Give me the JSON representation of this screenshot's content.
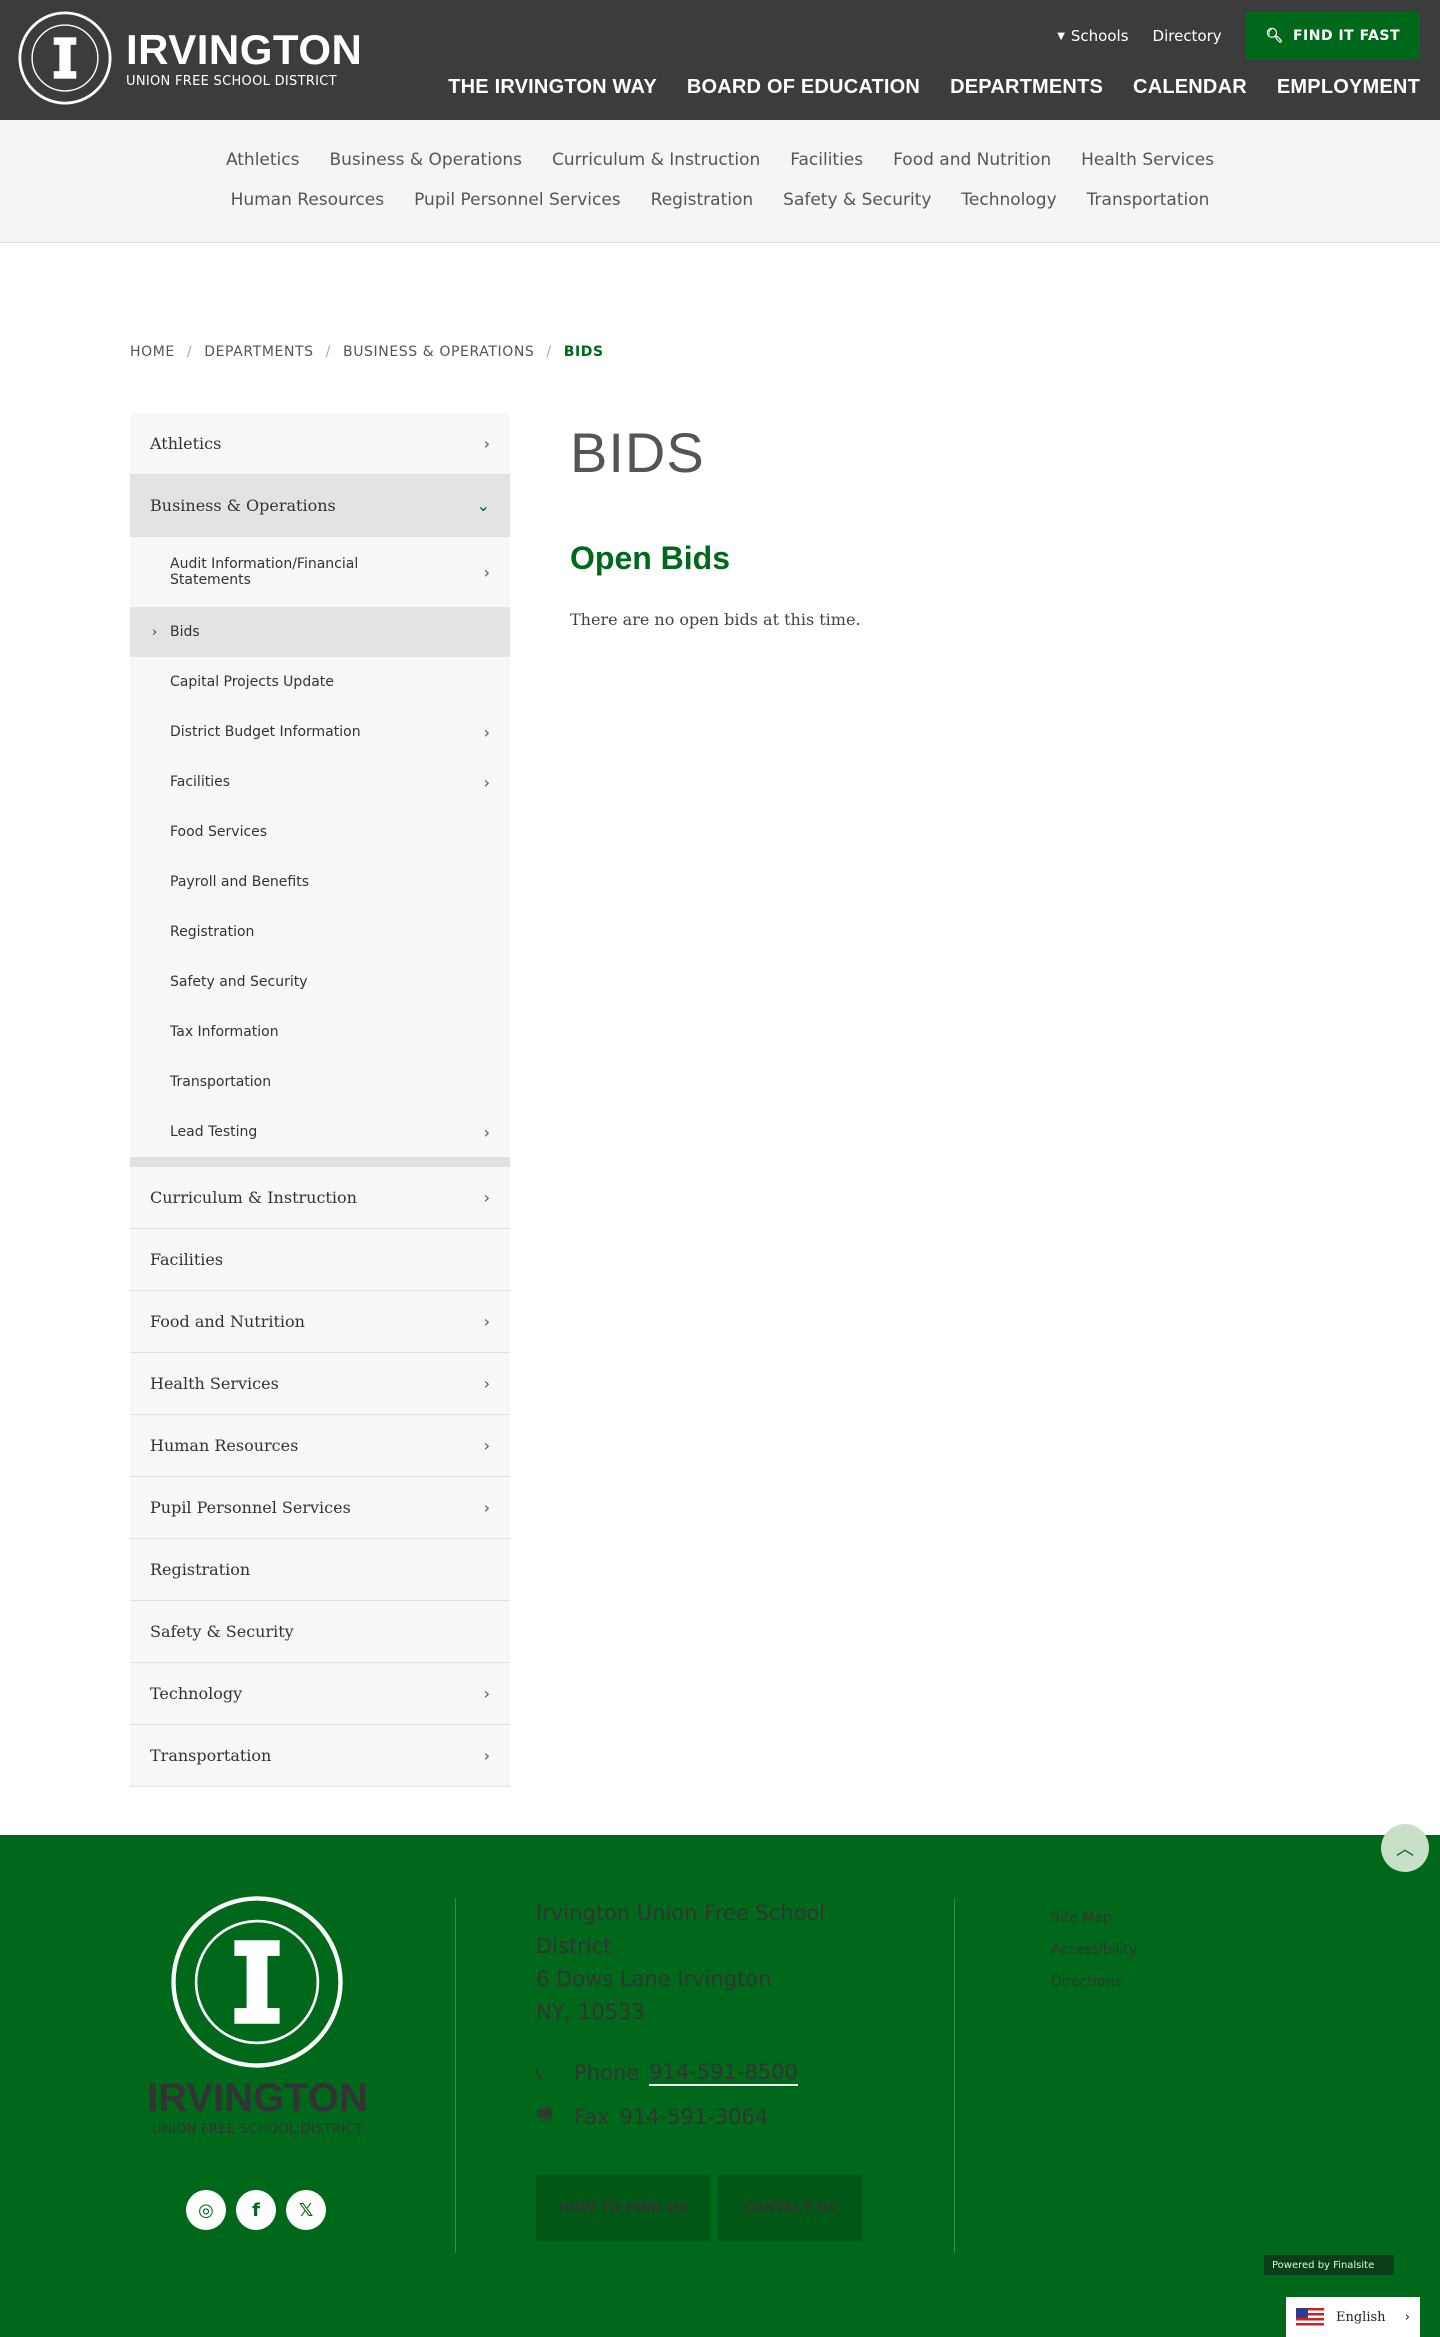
{
  "header": {
    "brand_name": "IRVINGTON",
    "brand_sub": "UNION FREE SCHOOL DISTRICT",
    "seal_text": "IRVINGTON · UNION FREE SCHOOL DISTRICT",
    "util": {
      "schools": "Schools",
      "directory": "Directory",
      "find_it_fast": "FIND IT FAST"
    },
    "main_nav": [
      "THE IRVINGTON WAY",
      "BOARD OF EDUCATION",
      "DEPARTMENTS",
      "CALENDAR",
      "EMPLOYMENT"
    ]
  },
  "subnav": {
    "row1": [
      "Athletics",
      "Business & Operations",
      "Curriculum & Instruction",
      "Facilities",
      "Food and Nutrition",
      "Health Services"
    ],
    "row2": [
      "Human Resources",
      "Pupil Personnel Services",
      "Registration",
      "Safety & Security",
      "Technology",
      "Transportation"
    ]
  },
  "breadcrumb": [
    "HOME",
    "DEPARTMENTS",
    "BUSINESS & OPERATIONS",
    "BIDS"
  ],
  "sidebar": {
    "top_before": [
      {
        "label": "Athletics",
        "has_children": true
      }
    ],
    "active": {
      "label": "Business & Operations"
    },
    "sub_items": [
      {
        "label": "Audit Information/Financial Statements",
        "has_children": true
      },
      {
        "label": "Bids",
        "has_children": false,
        "current": true
      },
      {
        "label": "Capital Projects Update",
        "has_children": false
      },
      {
        "label": "District Budget Information",
        "has_children": true
      },
      {
        "label": "Facilities",
        "has_children": true
      },
      {
        "label": "Food Services",
        "has_children": false
      },
      {
        "label": "Payroll and Benefits",
        "has_children": false
      },
      {
        "label": "Registration",
        "has_children": false
      },
      {
        "label": "Safety and Security",
        "has_children": false
      },
      {
        "label": "Tax Information",
        "has_children": false
      },
      {
        "label": "Transportation",
        "has_children": false
      },
      {
        "label": "Lead Testing",
        "has_children": true
      }
    ],
    "top_after": [
      {
        "label": "Curriculum & Instruction",
        "has_children": true
      },
      {
        "label": "Facilities",
        "has_children": false
      },
      {
        "label": "Food and Nutrition",
        "has_children": true
      },
      {
        "label": "Health Services",
        "has_children": true
      },
      {
        "label": "Human Resources",
        "has_children": true
      },
      {
        "label": "Pupil Personnel Services",
        "has_children": true
      },
      {
        "label": "Registration",
        "has_children": false
      },
      {
        "label": "Safety & Security",
        "has_children": false
      },
      {
        "label": "Technology",
        "has_children": true
      },
      {
        "label": "Transportation",
        "has_children": true
      }
    ]
  },
  "content": {
    "page_title": "BIDS",
    "section_title": "Open Bids",
    "body": "There are no open bids at this time."
  },
  "footer": {
    "brand_name": "IRVINGTON",
    "brand_sub": "UNION FREE SCHOOL DISTRICT",
    "address_lines": [
      "Irvington Union Free School",
      "District",
      "6 Dows Lane Irvington",
      "NY, 10533"
    ],
    "phone_label": "Phone",
    "phone": "914-591-8500",
    "fax_label": "Fax",
    "fax": "914-591-3064",
    "btn_find": "HOW TO FIND US",
    "btn_contact": "CONTACT US",
    "links": [
      "Site Map",
      "Accessibility",
      "Directions"
    ],
    "powered": "Powered by Finalsite",
    "language": "English"
  },
  "colors": {
    "brand_green": "#00681b",
    "header_bg": "#3c3c3c"
  }
}
